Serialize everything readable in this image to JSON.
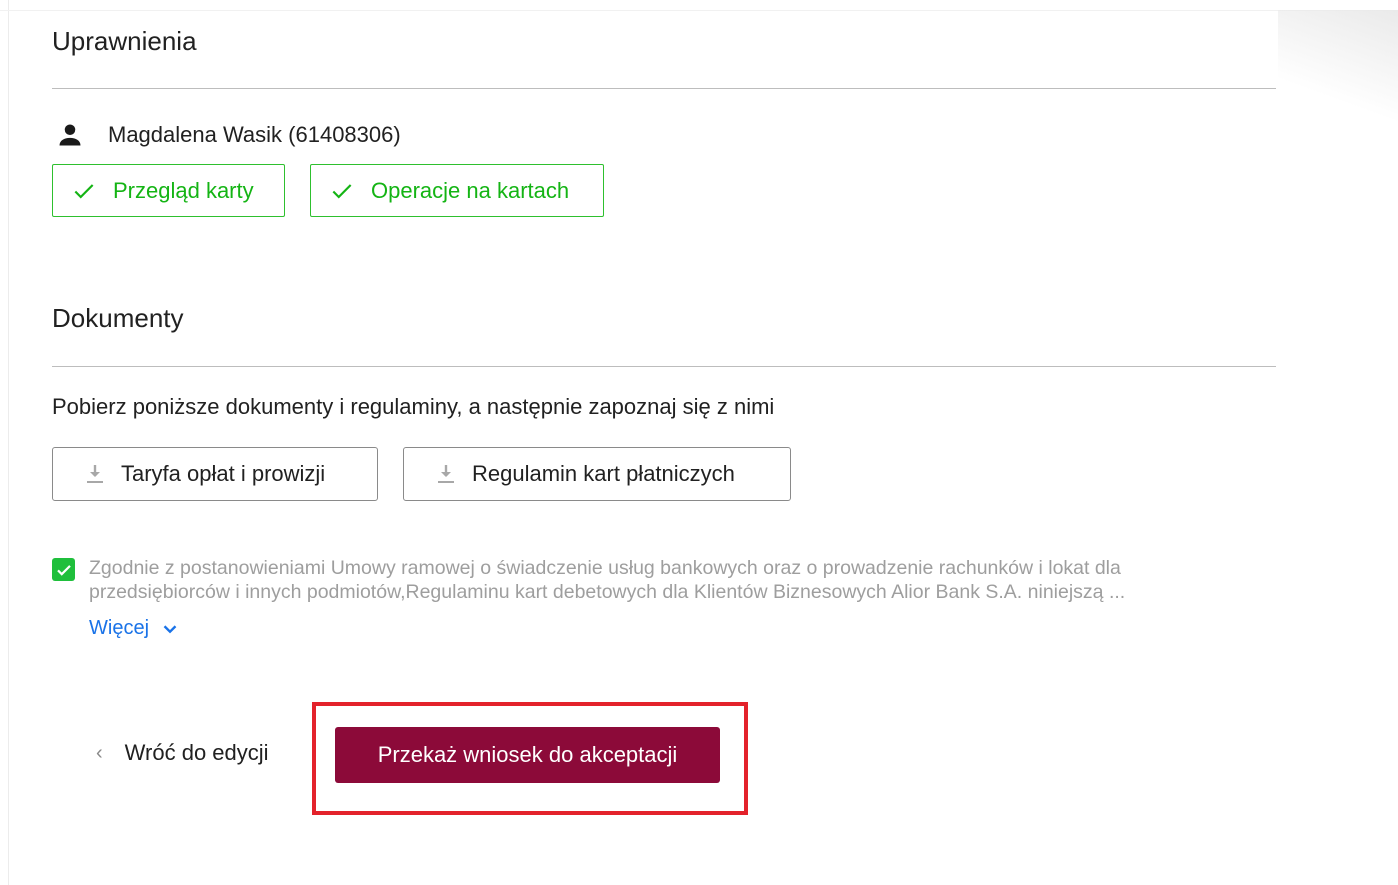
{
  "permissions": {
    "title": "Uprawnienia",
    "user_name": "Magdalena Wasik (61408306)",
    "user_icon": "person-icon",
    "chips": [
      {
        "label": "Przegląd karty",
        "icon": "check-icon"
      },
      {
        "label": "Operacje na kartach",
        "icon": "check-icon"
      }
    ],
    "chip_color": "#14b414"
  },
  "documents": {
    "title": "Dokumenty",
    "description": "Pobierz poniższe dokumenty i regulaminy, a następnie zapoznaj się z nimi",
    "buttons": [
      {
        "label": "Taryfa opłat i prowizji",
        "icon": "download-icon"
      },
      {
        "label": "Regulamin kart płatniczych",
        "icon": "download-icon"
      }
    ]
  },
  "consent": {
    "checked": true,
    "line1": "Zgodnie z postanowieniami Umowy ramowej o świadczenie usług bankowych oraz o prowadzenie rachunków i lokat dla",
    "line2": "przedsiębiorców i innych podmiotów,Regulaminu kart debetowych dla Klientów Biznesowych Alior Bank S.A. niniejszą ...",
    "more_label": "Więcej",
    "check_color": "#1fbf3c",
    "link_color": "#1a73e8"
  },
  "actions": {
    "back_label": "Wróć do edycji",
    "submit_label": "Przekaż wniosek do akceptacji",
    "submit_color": "#8c0a39",
    "highlight_color": "#e3222b"
  }
}
